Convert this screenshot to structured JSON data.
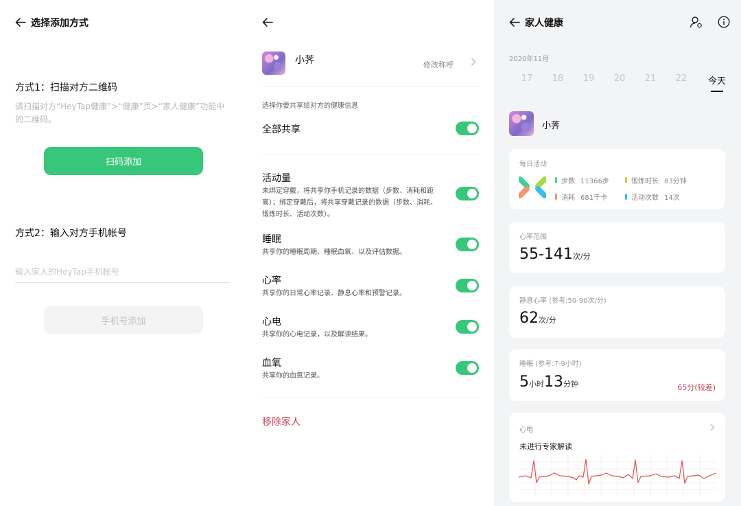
{
  "add_method": {
    "title": "选择添加方式",
    "method1_title": "方式1：扫描对方二维码",
    "method1_desc": "请扫描对方“HeyTap健康”>“健康”页>“家人健康”功能中的二维码。",
    "scan_button": "扫码添加",
    "method2_title": "方式2：输入对方手机帐号",
    "phone_placeholder": "输入家人的HeyTap手机帐号",
    "phone_button": "手机号添加"
  },
  "share_settings": {
    "name": "小荠",
    "rename_label": "修改称呼",
    "hint": "选择你要共享给对方的健康信息",
    "share_all_label": "全部共享",
    "items": [
      {
        "title": "活动量",
        "desc": "未绑定穿戴，将共享你手机记录的数据（步数、消耗和距离）；绑定穿戴后，将共享穿戴记录的数据（步数、消耗、锻炼时长、活动次数）。",
        "enabled": true
      },
      {
        "title": "睡眠",
        "desc": "共享你的睡眠周期、睡眠血氧、以及评估数据。",
        "enabled": true
      },
      {
        "title": "心率",
        "desc": "共享你的日常心率记录、静息心率和预警记录。",
        "enabled": true
      },
      {
        "title": "心电",
        "desc": "共享你的心电记录，以及解读结果。",
        "enabled": true
      },
      {
        "title": "血氧",
        "desc": "共享你的血氧记录。",
        "enabled": true
      }
    ],
    "remove_label": "移除家人"
  },
  "family_health": {
    "title": "家人健康",
    "month": "2020年11月",
    "days": [
      "17",
      "18",
      "19",
      "20",
      "21",
      "22",
      "今天"
    ],
    "name": "小荠",
    "activity": {
      "label": "每日活动",
      "steps_label": "步数",
      "steps_value": "11366步",
      "exercise_label": "锻炼时长",
      "exercise_value": "83分钟",
      "calories_label": "消耗",
      "calories_value": "681千卡",
      "activity_label": "活动次数",
      "activity_value": "14次"
    },
    "heart_rate": {
      "label": "心率范围",
      "value": "55-141",
      "unit": "次/分"
    },
    "resting_hr": {
      "label": "静息心率 (参考:50-90次/分)",
      "value": "62",
      "unit": "次/分"
    },
    "sleep": {
      "label": "睡眠 (参考:7-9小时)",
      "hours": "5",
      "hours_unit": "小时",
      "minutes": "13",
      "minutes_unit": "分钟",
      "score": "65分(较差)"
    },
    "ecg": {
      "label": "心电",
      "status": "未进行专家解读"
    }
  },
  "colors": {
    "accent_green": "#37c77a",
    "danger_red": "#c0455a",
    "steps": "#3fd39a",
    "exercise": "#a7dc3f",
    "calories": "#f2966b",
    "activity_count": "#38c0e8",
    "ecg_line": "#d9534f"
  },
  "icons": {
    "back": "back-arrow-icon",
    "chevron": "chevron-right-icon",
    "person": "person-settings-icon",
    "info": "info-icon"
  }
}
